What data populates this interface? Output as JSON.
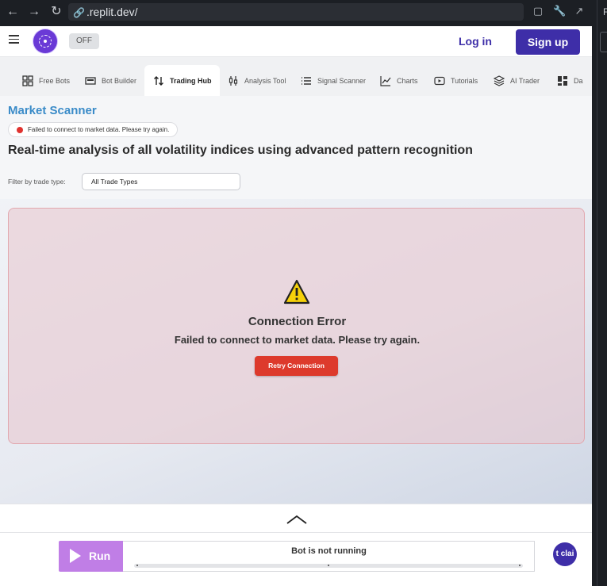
{
  "browser": {
    "url": ".replit.dev/",
    "side_tab_initial": "F"
  },
  "header": {
    "toggle_label": "OFF",
    "login_label": "Log in",
    "signup_label": "Sign up",
    "brand_color": "#3e2ea8"
  },
  "tabs": [
    {
      "label": "Free Bots",
      "icon": "grid-icon"
    },
    {
      "label": "Bot Builder",
      "icon": "builder-icon"
    },
    {
      "label": "Trading Hub",
      "icon": "swap-arrows-icon",
      "active": true
    },
    {
      "label": "Analysis Tool",
      "icon": "candles-icon"
    },
    {
      "label": "Signal Scanner",
      "icon": "list-icon"
    },
    {
      "label": "Charts",
      "icon": "line-chart-icon"
    },
    {
      "label": "Tutorials",
      "icon": "video-icon"
    },
    {
      "label": "AI Trader",
      "icon": "layers-icon"
    },
    {
      "label": "Da",
      "icon": "dashboard-icon"
    }
  ],
  "scanner": {
    "title": "Market Scanner",
    "status_pill": "Failed to connect to market data. Please try again.",
    "subtitle": "Real-time analysis of all volatility indices using advanced pattern recognition",
    "filter_label": "Filter by trade type:",
    "filter_value": "All Trade Types"
  },
  "error_card": {
    "title": "Connection Error",
    "message": "Failed to connect to market data. Please try again.",
    "retry_label": "Retry Connection",
    "accent_color": "#dd3a2c"
  },
  "bottom_bar": {
    "run_label": "Run",
    "status": "Bot is not running",
    "chat_text": "t\nclai",
    "run_color": "#c07ee6"
  }
}
